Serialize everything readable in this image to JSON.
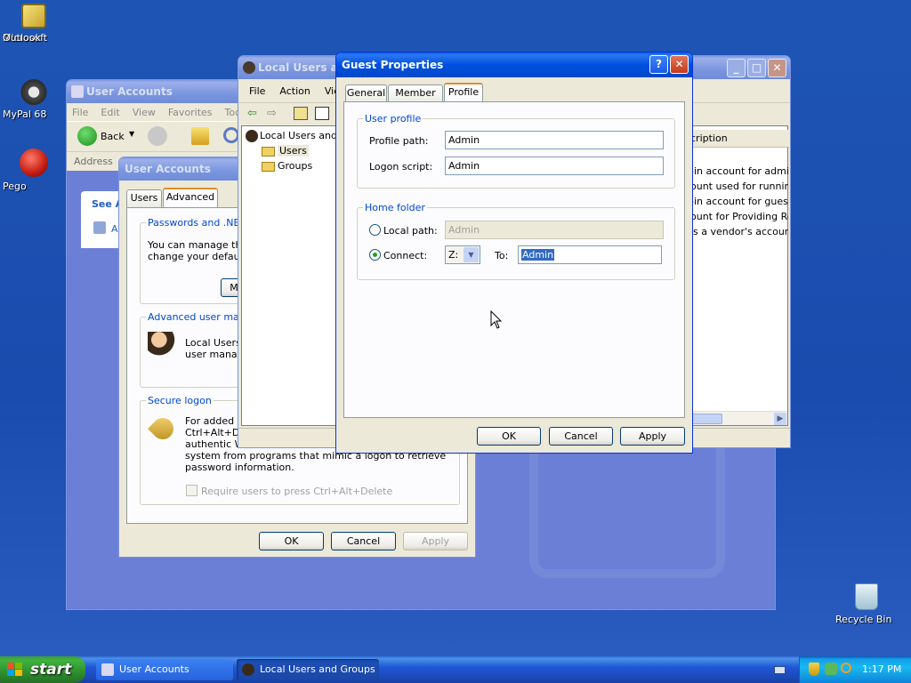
{
  "desktop": {
    "icons": [
      {
        "name": "Microsoft Outlook",
        "label1": "Microsoft",
        "label2": "Outlook"
      },
      {
        "name": "MyPal 68",
        "label1": "MyPal 68"
      },
      {
        "name": "Pego",
        "label1": "Pego"
      },
      {
        "name": "Recycle Bin",
        "label1": "Recycle Bin"
      }
    ]
  },
  "user_accounts_back": {
    "title": "User Accounts",
    "menu": [
      "File",
      "Edit",
      "View",
      "Favorites",
      "Too"
    ],
    "back_label": "Back",
    "address_label": "Address",
    "see_also": "See A",
    "link_text": "A"
  },
  "user_accounts_dialog": {
    "title": "User Accounts",
    "tabs": [
      "Users",
      "Advanced"
    ],
    "passwords_group": "Passwords and .NET I",
    "passwords_text1": "You can manage the",
    "passwords_text2": "change your default",
    "manage_btn": "M",
    "advanced_group": "Advanced user manag",
    "advanced_text1": "Local Users a",
    "advanced_text2": "user manage",
    "secure_group": "Secure logon",
    "secure_text1": "For added se",
    "secure_text2": "Ctrl+Alt+Del",
    "secure_text3": "authentic Wi",
    "secure_text4": "system from programs that mimic a logon to retrieve",
    "secure_text5": "password information.",
    "require_label": "Require users to press Ctrl+Alt+Delete",
    "ok": "OK",
    "cancel": "Cancel",
    "apply": "Apply"
  },
  "lusrmgr": {
    "title": "Local Users a",
    "menu": [
      "File",
      "Action",
      "View"
    ],
    "tree_root": "Local Users and",
    "tree_users": "Users",
    "tree_groups": "Groups",
    "col_description": "cription",
    "descriptions": [
      "-in account for adminis",
      "ount used for running",
      "-in account for guest a",
      "ount for Providing Rem",
      "is a vendor's account"
    ]
  },
  "guest_properties": {
    "title": "Guest Properties",
    "tabs": [
      "General",
      "Member Of",
      "Profile"
    ],
    "user_profile_group": "User profile",
    "profile_path_label": "Profile path:",
    "profile_path_value": "Admin",
    "logon_script_label": "Logon script:",
    "logon_script_value": "Admin",
    "home_folder_group": "Home folder",
    "local_path_label": "Local path:",
    "local_path_value": "Admin",
    "connect_label": "Connect:",
    "drive_value": "Z:",
    "to_label": "To:",
    "to_value": "Admin",
    "ok": "OK",
    "cancel": "Cancel",
    "apply": "Apply",
    "help_btn": "?",
    "close_btn": "✕"
  },
  "taskbar": {
    "start": "start",
    "tasks": [
      "User Accounts",
      "Local Users and Groups"
    ],
    "clock": "1:17 PM"
  }
}
